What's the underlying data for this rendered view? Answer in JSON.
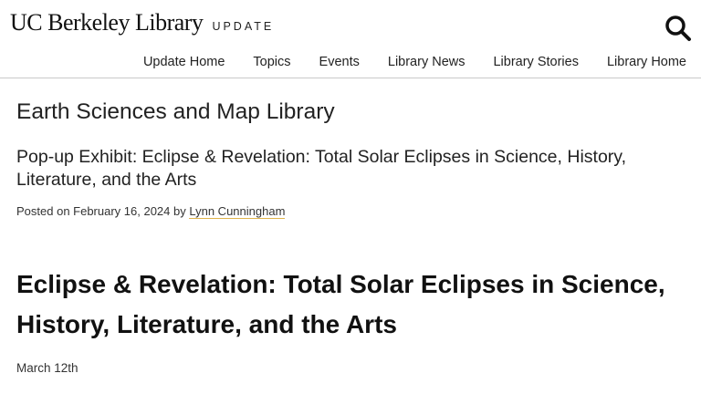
{
  "header": {
    "brand": "UC Berkeley Library",
    "subbrand": "UPDATE",
    "search_icon": "search-icon",
    "nav": [
      {
        "label": "Update Home"
      },
      {
        "label": "Topics"
      },
      {
        "label": "Events"
      },
      {
        "label": "Library News"
      },
      {
        "label": "Library Stories"
      },
      {
        "label": "Library Home"
      }
    ]
  },
  "page": {
    "section_title": "Earth Sciences and Map Library",
    "subtitle": "Pop-up Exhibit: Eclipse & Revelation: Total Solar Eclipses in Science, History, Literature, and the Arts",
    "posted_prefix": "Posted on February 16, 2024 by ",
    "author": "Lynn Cunningham",
    "heading": "Eclipse & Revelation: Total Solar Eclipses in Science, History, Literature, and the Arts",
    "date": "March 12th"
  },
  "colors": {
    "author_underline": "#e0b44b",
    "divider": "#c9c9c9"
  }
}
